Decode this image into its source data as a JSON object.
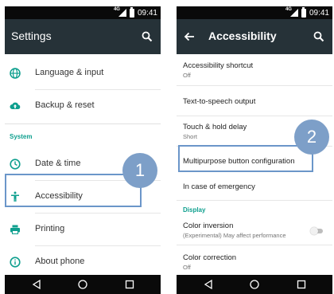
{
  "left": {
    "status": {
      "network": "4G",
      "time": "09:41"
    },
    "appbar": {
      "title": "Settings"
    },
    "items_top": [
      {
        "label": "Language & input",
        "icon": "globe-icon"
      },
      {
        "label": "Backup & reset",
        "icon": "cloud-upload-icon"
      }
    ],
    "section": "System",
    "items": [
      {
        "label": "Date & time",
        "icon": "clock-icon"
      },
      {
        "label": "Accessibility",
        "icon": "accessibility-icon"
      },
      {
        "label": "Printing",
        "icon": "printer-icon"
      },
      {
        "label": "About phone",
        "icon": "info-icon"
      }
    ],
    "callout": "1"
  },
  "right": {
    "status": {
      "network": "4G",
      "time": "09:41"
    },
    "appbar": {
      "title": "Accessibility"
    },
    "items": [
      {
        "title": "Accessibility shortcut",
        "subtitle": "Off"
      },
      {
        "title": "Text-to-speech output"
      },
      {
        "title": "Touch & hold delay",
        "subtitle": "Short"
      },
      {
        "title": "Multipurpose button configuration"
      },
      {
        "title": "In case of emergency"
      }
    ],
    "section": "Display",
    "display_items": [
      {
        "title": "Color inversion",
        "subtitle": "(Experimental) May affect performance",
        "toggle": false
      },
      {
        "title": "Color correction",
        "subtitle": "Off"
      }
    ],
    "callout": "2"
  },
  "colors": {
    "appbar": "#263238",
    "accent": "#0e9f8e",
    "highlight": "#6b96c9",
    "badge": "#7d9fc8"
  }
}
